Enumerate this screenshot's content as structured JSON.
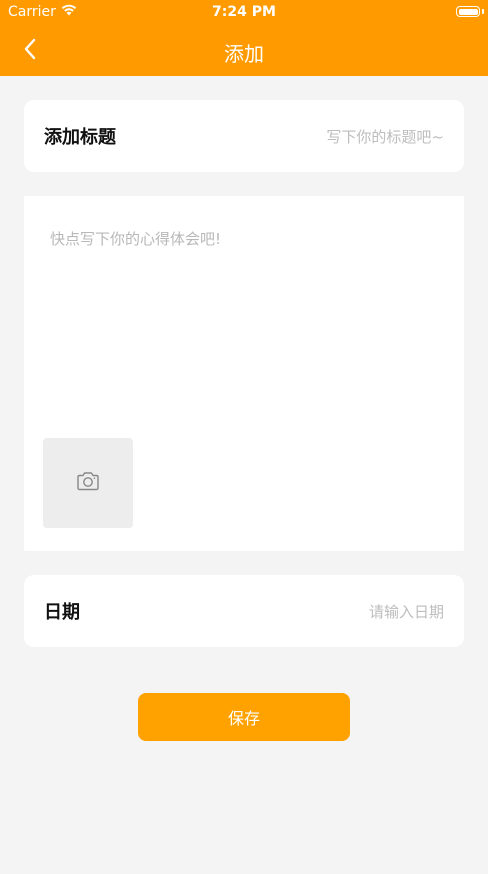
{
  "status_bar": {
    "carrier": "Carrier",
    "time": "7:24 PM",
    "wifi_icon": "wifi-icon",
    "battery_icon": "battery-icon"
  },
  "nav": {
    "title": "添加",
    "back_icon": "chevron-left-icon"
  },
  "form": {
    "title_label": "添加标题",
    "title_placeholder": "写下你的标题吧~",
    "content_placeholder": "快点写下你的心得体会吧!",
    "photo_icon": "camera-icon",
    "date_label": "日期",
    "date_placeholder": "请输入日期"
  },
  "actions": {
    "save_label": "保存"
  },
  "colors": {
    "header": "#ff9b00",
    "button": "#ffa200",
    "background": "#f4f4f4"
  }
}
